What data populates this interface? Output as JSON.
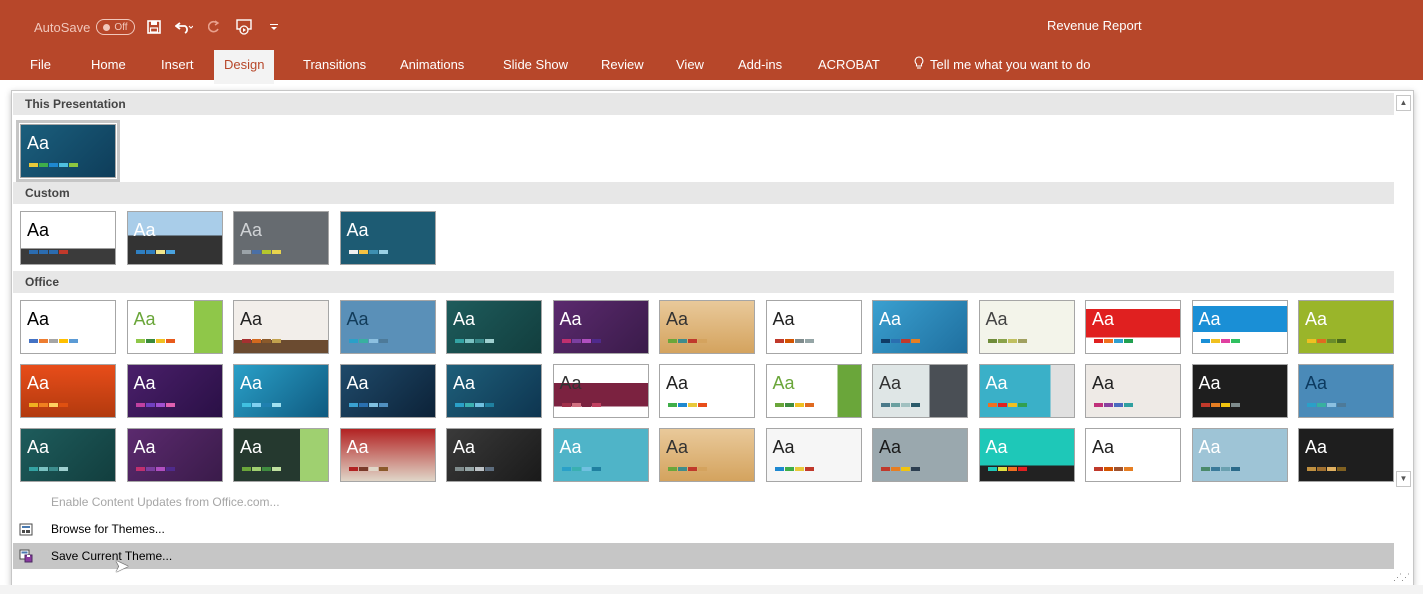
{
  "title_bar": {
    "autosave_label": "AutoSave",
    "autosave_state": "Off",
    "doc_title": "Revenue Report",
    "qat_icons": [
      "save-icon",
      "undo-icon",
      "redo-icon",
      "start-from-beginning-icon",
      "customize-qat-icon"
    ]
  },
  "tabs": [
    {
      "label": "File"
    },
    {
      "label": "Home"
    },
    {
      "label": "Insert"
    },
    {
      "label": "Design",
      "active": true
    },
    {
      "label": "Transitions"
    },
    {
      "label": "Animations"
    },
    {
      "label": "Slide Show"
    },
    {
      "label": "Review"
    },
    {
      "label": "View"
    },
    {
      "label": "Add-ins"
    },
    {
      "label": "ACROBAT"
    }
  ],
  "tell_me": "Tell me what you want to do",
  "gallery": {
    "sections": {
      "this_presentation": "This Presentation",
      "custom": "Custom",
      "office": "Office"
    },
    "theme_sample_text": "Aa"
  },
  "themes": {
    "this_presentation": [
      {
        "bg": "linear-gradient(135deg,#1b5f7d,#0e3d5a)",
        "fg": "#ffffff",
        "sw": [
          "#e8c93a",
          "#3fae49",
          "#1e88d0",
          "#4fc0e0",
          "#8dc63f"
        ]
      }
    ],
    "custom": [
      {
        "bg": "linear-gradient(#ffffff 70%, #3b3b3b 70%)",
        "fg": "#000000",
        "sw": [
          "#2b6cb0",
          "#2b6cb0",
          "#2b6cb0",
          "#c0392b"
        ]
      },
      {
        "bg": "linear-gradient(#a9cde9 45%, #333333 45%)",
        "fg": "#ffffff",
        "sw": [
          "#2f7fc1",
          "#2f7fc1",
          "#f0e68c",
          "#4aa3df"
        ]
      },
      {
        "bg": "#666b70",
        "fg": "#cfd2d5",
        "sw": [
          "#9ba3a9",
          "#4a6fa5",
          "#b4c72d",
          "#e8d44d"
        ]
      },
      {
        "bg": "#1d5b73",
        "fg": "#ffffff",
        "sw": [
          "#f0f0f0",
          "#f5c242",
          "#3e8fb0",
          "#9ad0e4"
        ]
      }
    ],
    "office": [
      {
        "bg": "#ffffff",
        "fg": "#000000",
        "sw": [
          "#4472c4",
          "#ed7d31",
          "#a5a5a5",
          "#ffc000",
          "#5b9bd5"
        ]
      },
      {
        "bg": "linear-gradient(90deg,#ffffff 70%,#8fc749 70%)",
        "fg": "#6aa63a",
        "sw": [
          "#8fc749",
          "#3a8a3a",
          "#f0c020",
          "#e85a1c"
        ]
      },
      {
        "bg": "linear-gradient(#f2eeea 75%,#6b4b30 75%)",
        "fg": "#222222",
        "sw": [
          "#a53030",
          "#d2691e",
          "#8b5a2b",
          "#c2a14d"
        ]
      },
      {
        "bg": "#5a90b8",
        "fg": "#123c5a",
        "sw": [
          "#2aa0c8",
          "#38b0a0",
          "#8cc0e0",
          "#4d7a99"
        ]
      },
      {
        "bg": "linear-gradient(135deg,#1e5c5c,#123e3e)",
        "fg": "#ffffff",
        "sw": [
          "#33a3a3",
          "#7ac2c2",
          "#3b8c8c",
          "#9fd0d0"
        ]
      },
      {
        "bg": "linear-gradient(135deg,#5b2a6e,#3a1b4a)",
        "fg": "#ffffff",
        "sw": [
          "#c0306f",
          "#7b3fa0",
          "#b04fc0",
          "#4f2a8c"
        ]
      },
      {
        "bg": "linear-gradient(#e9c99a,#d4a35e)",
        "fg": "#333333",
        "sw": [
          "#6aa63a",
          "#3f8c8c",
          "#c0392b",
          "#d4a35e"
        ]
      },
      {
        "bg": "#ffffff",
        "fg": "#222222",
        "sw": [
          "#c0392b",
          "#d35400",
          "#7f8c8d",
          "#95a5a6"
        ]
      },
      {
        "bg": "linear-gradient(135deg,#3aa0d0,#1f6f9f)",
        "fg": "#ffffff",
        "sw": [
          "#0f3b66",
          "#2a6fb0",
          "#c0392b",
          "#e67e22"
        ]
      },
      {
        "bg": "#f3f4ea",
        "fg": "#444444",
        "sw": [
          "#6f8c3a",
          "#8aa34a",
          "#c0c060",
          "#a0a060"
        ]
      },
      {
        "bg": "linear-gradient(#ffffff 15%,#e02020 15%,#e02020 70%,#ffffff 70%)",
        "fg": "#ffffff",
        "sw": [
          "#e02020",
          "#f07020",
          "#30a0d0",
          "#20a050"
        ]
      },
      {
        "bg": "linear-gradient(#ffffff 10%,#1a8fd6 10%,#1a8fd6 60%,#ffffff 60%)",
        "fg": "#ffffff",
        "sw": [
          "#1a8fd6",
          "#f0c020",
          "#e040a0",
          "#30c060"
        ]
      },
      {
        "bg": "#9ab52a",
        "fg": "#ffffff",
        "sw": [
          "#f0c020",
          "#e06a20",
          "#6a8c2a",
          "#4a6a1a"
        ]
      },
      {
        "bg": "linear-gradient(#e84d1a,#b23a0e)",
        "fg": "#ffffff",
        "sw": [
          "#f0b020",
          "#f08020",
          "#ffd060",
          "#e05010"
        ]
      },
      {
        "bg": "linear-gradient(135deg,#4a1f6a,#2a1046)",
        "fg": "#ffffff",
        "sw": [
          "#c040a0",
          "#7040c0",
          "#a050d0",
          "#e060b0"
        ]
      },
      {
        "bg": "linear-gradient(135deg,#2aa0c8,#0f5a80)",
        "fg": "#ffffff",
        "sw": [
          "#40c0e0",
          "#80d0f0",
          "#2080b0",
          "#a0e0f0"
        ]
      },
      {
        "bg": "linear-gradient(135deg,#1f4a6a,#0c2238)",
        "fg": "#ffffff",
        "sw": [
          "#3aa0d0",
          "#2a70b0",
          "#80c0e0",
          "#5090c0"
        ]
      },
      {
        "bg": "linear-gradient(135deg,#1e5f7a,#0e3550)",
        "fg": "#ffffff",
        "sw": [
          "#2aa0c8",
          "#3ab0b0",
          "#70c0e0",
          "#1f80a0"
        ]
      },
      {
        "bg": "linear-gradient(#ffffff 35%,#7b2240 35%,#7b2240 80%,#ffffff 80%)",
        "fg": "#333333",
        "sw": [
          "#a0304a",
          "#d07080",
          "#7b2240",
          "#c04060"
        ]
      },
      {
        "bg": "#ffffff",
        "fg": "#222222",
        "sw": [
          "#3fae49",
          "#1e88d0",
          "#e8c93a",
          "#e84d1a"
        ]
      },
      {
        "bg": "linear-gradient(90deg,#ffffff 75%,#6aa63a 75%)",
        "fg": "#6aa63a",
        "sw": [
          "#6aa63a",
          "#3f8c3f",
          "#f0c020",
          "#e06a20"
        ]
      },
      {
        "bg": "linear-gradient(90deg,#dfe6e6 60%,#4a4f55 60%)",
        "fg": "#333333",
        "sw": [
          "#4a7a8a",
          "#6aa0a0",
          "#a0c0c0",
          "#2a5a6a"
        ]
      },
      {
        "bg": "linear-gradient(90deg,#3ab0c8 75%,#e0e0e0 75%)",
        "fg": "#ffffff",
        "sw": [
          "#f07020",
          "#e02020",
          "#f0c020",
          "#30a050"
        ]
      },
      {
        "bg": "#eeeae6",
        "fg": "#222222",
        "sw": [
          "#c0307a",
          "#8a40a0",
          "#4a6ac0",
          "#30a0a0"
        ]
      },
      {
        "bg": "#1e1e1e",
        "fg": "#ffffff",
        "sw": [
          "#c0392b",
          "#e67e22",
          "#f1c40f",
          "#7f8c8d"
        ]
      },
      {
        "bg": "#4a8ab8",
        "fg": "#0c3a60",
        "sw": [
          "#2aa0c8",
          "#38b0a0",
          "#8cc0e0",
          "#4d7a99"
        ]
      },
      {
        "bg": "linear-gradient(135deg,#1e5c5c,#123e3e)",
        "fg": "#ffffff",
        "sw": [
          "#33a3a3",
          "#7ac2c2",
          "#3b8c8c",
          "#9fd0d0"
        ]
      },
      {
        "bg": "linear-gradient(135deg,#5b2a6e,#3a1b4a)",
        "fg": "#ffffff",
        "sw": [
          "#c0306f",
          "#7b3fa0",
          "#b04fc0",
          "#4f2a8c"
        ]
      },
      {
        "bg": "linear-gradient(90deg,#25392f 70%,#9fd070 70%)",
        "fg": "#ffffff",
        "sw": [
          "#6aa63a",
          "#9fd070",
          "#3f8c3f",
          "#c0e0a0"
        ]
      },
      {
        "bg": "linear-gradient(#b22222,#e0d6c8)",
        "fg": "#ffffff",
        "sw": [
          "#b22222",
          "#7a3a2a",
          "#e0d6c8",
          "#8b5a2b"
        ]
      },
      {
        "bg": "linear-gradient(135deg,#3a3a3a,#1a1a1a)",
        "fg": "#ffffff",
        "sw": [
          "#7f8c8d",
          "#95a5a6",
          "#bdc3c7",
          "#5d6d7e"
        ]
      },
      {
        "bg": "#4fb4c8",
        "fg": "#ffffff",
        "sw": [
          "#2aa0c8",
          "#3ab0b0",
          "#70c0e0",
          "#1f80a0"
        ]
      },
      {
        "bg": "linear-gradient(#e9c99a,#d4a35e)",
        "fg": "#333333",
        "sw": [
          "#6aa63a",
          "#3f8c8c",
          "#c0392b",
          "#d4a35e"
        ]
      },
      {
        "bg": "#f6f6f6",
        "fg": "#222222",
        "sw": [
          "#1e88d0",
          "#3fae49",
          "#e8c93a",
          "#c0392b"
        ]
      },
      {
        "bg": "#9aa8ae",
        "fg": "#1a1a1a",
        "sw": [
          "#c0392b",
          "#e67e22",
          "#f1c40f",
          "#2c3e50"
        ]
      },
      {
        "bg": "linear-gradient(#1ec8b8 70%,#222222 70%)",
        "fg": "#ffffff",
        "sw": [
          "#1ec8b8",
          "#e0e040",
          "#f07020",
          "#e02020"
        ]
      },
      {
        "bg": "#ffffff",
        "fg": "#222222",
        "sw": [
          "#c0392b",
          "#d35400",
          "#a0522d",
          "#e67e22"
        ]
      },
      {
        "bg": "#9ec4d6",
        "fg": "#ffffff",
        "sw": [
          "#4a8a6a",
          "#3a7a9a",
          "#6aa0b0",
          "#2a6a8a"
        ]
      },
      {
        "bg": "#1e1e1e",
        "fg": "#ffffff",
        "sw": [
          "#c09040",
          "#a07030",
          "#e0b060",
          "#806020"
        ]
      }
    ]
  },
  "menu": {
    "enable_updates": "Enable Content Updates from Office.com...",
    "browse_themes": "Browse for Themes...",
    "save_theme": "Save Current Theme..."
  }
}
